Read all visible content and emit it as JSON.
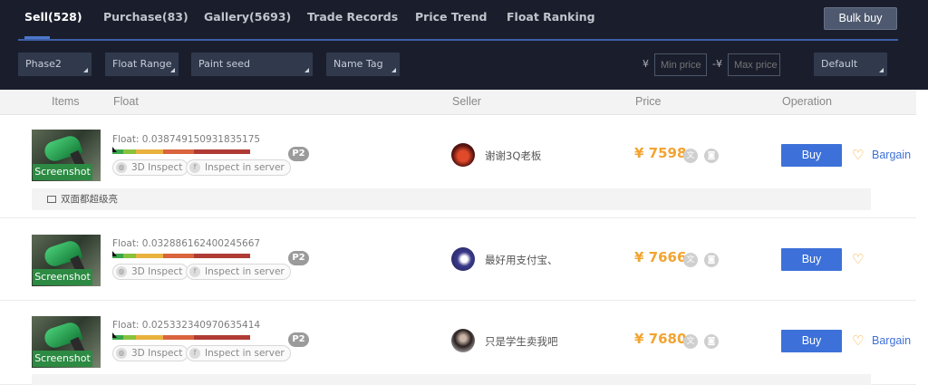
{
  "tabs": [
    {
      "label": "Sell(528)",
      "active": true
    },
    {
      "label": "Purchase(83)"
    },
    {
      "label": "Gallery(5693)"
    },
    {
      "label": "Trade Records"
    },
    {
      "label": "Price Trend"
    },
    {
      "label": "Float Ranking"
    }
  ],
  "bulk_buy_label": "Bulk buy",
  "filters": {
    "phase": "Phase2",
    "float_range": "Float Range",
    "paint_seed": "Paint seed",
    "name_tag": "Name Tag",
    "currency_min": "¥",
    "currency_max": "-¥",
    "min_price_placeholder": "Min price",
    "max_price_placeholder": "Max price",
    "sort": "Default"
  },
  "columns": {
    "items": "Items",
    "float": "Float",
    "seller": "Seller",
    "price": "Price",
    "operation": "Operation"
  },
  "accent_colors": {
    "buy": "#3d71d9",
    "price": "#f2a431",
    "screenshot": "#2d8a43"
  },
  "listings": [
    {
      "screenshot_label": "Screenshot",
      "float_label": "Float: 0.038749150931835175",
      "float_value": 0.038749150931835175,
      "inspect_3d": "3D Inspect",
      "inspect_server": "Inspect in server",
      "phase_badge": "P2",
      "seller": "谢谢3Q老板",
      "price": "¥ 7598",
      "buy_label": "Buy",
      "bargain_label": "Bargain",
      "note": "双面都超级亮"
    },
    {
      "screenshot_label": "Screenshot",
      "float_label": "Float: 0.032886162400245667",
      "float_value": 0.032886162400245667,
      "inspect_3d": "3D Inspect",
      "inspect_server": "Inspect in server",
      "phase_badge": "P2",
      "seller": "最好用支付宝、",
      "price": "¥ 7666",
      "buy_label": "Buy",
      "bargain_label": "",
      "note": ""
    },
    {
      "screenshot_label": "Screenshot",
      "float_label": "Float: 0.025332340970635414",
      "float_value": 0.025332340970635414,
      "inspect_3d": "3D Inspect",
      "inspect_server": "Inspect in server",
      "phase_badge": "P2",
      "seller": "只是学生卖我吧",
      "price": "¥ 7680",
      "buy_label": "Buy",
      "bargain_label": "Bargain",
      "note": ""
    }
  ]
}
